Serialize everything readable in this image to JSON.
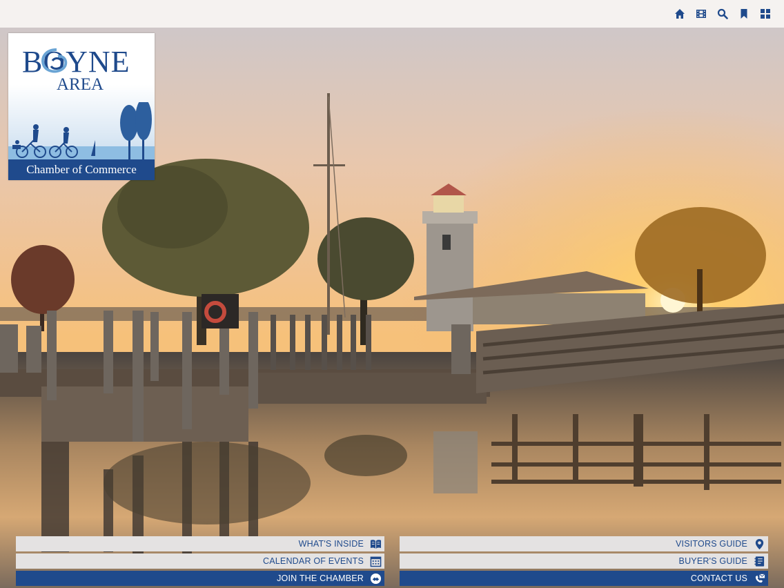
{
  "topbar": {
    "icons": [
      "home-icon",
      "filmstrip-icon",
      "search-icon",
      "bookmark-icon",
      "grid-icon"
    ],
    "icon_color": "#1f4a8c",
    "background": "#f5f2f0"
  },
  "logo": {
    "brand_line1": "BOYNE",
    "brand_line2": "AREA",
    "tagline": "Chamber of Commerce",
    "color": "#1f4a8c"
  },
  "buttons": {
    "whats_inside": "WHAT'S INSIDE",
    "calendar": "CALENDAR OF EVENTS",
    "join": "JOIN THE CHAMBER",
    "visitors": "VISITORS GUIDE",
    "buyers": "BUYER'S GUIDE",
    "contact": "CONTACT US"
  },
  "colors": {
    "accent": "#1f4a8c",
    "button_light": "#e4e2e2",
    "button_dark": "#1f4a8c"
  }
}
